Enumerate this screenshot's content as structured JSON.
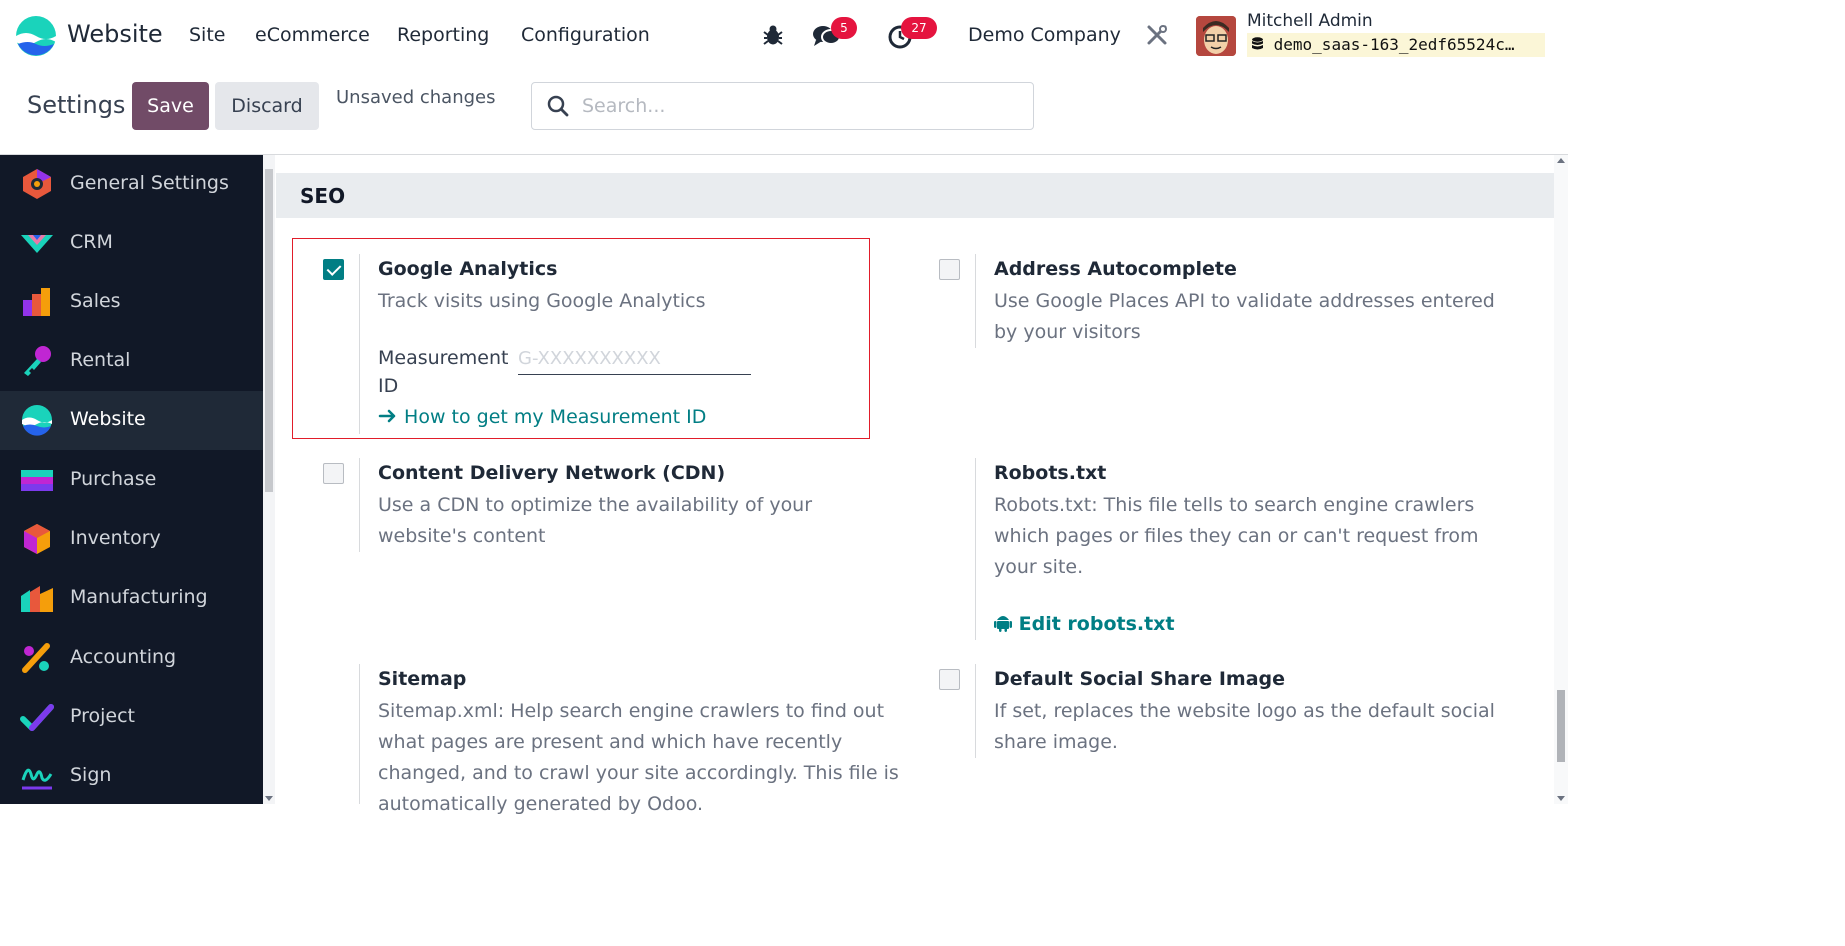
{
  "navbar": {
    "app_name": "Website",
    "menu": [
      "Site",
      "eCommerce",
      "Reporting",
      "Configuration"
    ],
    "messages_count": "5",
    "activities_count": "27",
    "company": "Demo Company",
    "user_name": "Mitchell Admin",
    "database": "demo_saas-163_2edf65524c…"
  },
  "control_panel": {
    "title": "Settings",
    "save_label": "Save",
    "discard_label": "Discard",
    "unsaved_text": "Unsaved changes",
    "search_placeholder": "Search..."
  },
  "sidebar": {
    "items": [
      {
        "label": "General Settings",
        "icon": "general-settings-icon"
      },
      {
        "label": "CRM",
        "icon": "crm-icon"
      },
      {
        "label": "Sales",
        "icon": "sales-icon"
      },
      {
        "label": "Rental",
        "icon": "rental-icon"
      },
      {
        "label": "Website",
        "icon": "website-icon",
        "active": true
      },
      {
        "label": "Purchase",
        "icon": "purchase-icon"
      },
      {
        "label": "Inventory",
        "icon": "inventory-icon"
      },
      {
        "label": "Manufacturing",
        "icon": "manufacturing-icon"
      },
      {
        "label": "Accounting",
        "icon": "accounting-icon"
      },
      {
        "label": "Project",
        "icon": "project-icon"
      },
      {
        "label": "Sign",
        "icon": "sign-icon"
      }
    ]
  },
  "section": {
    "title": "SEO",
    "settings": {
      "google_analytics": {
        "title": "Google Analytics",
        "desc": "Track visits using Google Analytics",
        "checked": true,
        "field_label_line1": "Measurement",
        "field_label_line2": "ID",
        "field_placeholder": "G-XXXXXXXXXX",
        "help_link": "How to get my Measurement ID"
      },
      "address_autocomplete": {
        "title": "Address Autocomplete",
        "desc_line1": "Use Google Places API to validate addresses entered",
        "desc_line2": "by your visitors",
        "checked": false
      },
      "cdn": {
        "title": "Content Delivery Network (CDN)",
        "desc_line1": "Use a CDN to optimize the availability of your",
        "desc_line2": "website's content",
        "checked": false
      },
      "robots": {
        "title": "Robots.txt",
        "desc_line1": "Robots.txt: This file tells to search engine crawlers",
        "desc_line2": "which pages or files they can or can't request from",
        "desc_line3": "your site.",
        "link": "Edit robots.txt"
      },
      "sitemap": {
        "title": "Sitemap",
        "desc_line1": "Sitemap.xml: Help search engine crawlers to find out",
        "desc_line2": "what pages are present and which have recently",
        "desc_line3": "changed, and to crawl your site accordingly. This file is",
        "desc_line4": "automatically generated by Odoo."
      },
      "social_share": {
        "title": "Default Social Share Image",
        "desc_line1": "If set, replaces the website logo as the default social",
        "desc_line2": "share image.",
        "checked": false
      }
    }
  }
}
